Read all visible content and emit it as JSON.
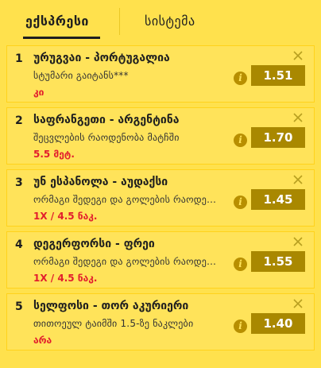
{
  "tabs": [
    {
      "label": "ექსპრესი"
    },
    {
      "label": "სისტემა"
    }
  ],
  "bets": [
    {
      "number": "1",
      "title": "ურუგვაი - პორტუგალია",
      "market": "სტუმარი გაიტანს***",
      "pick": "კი",
      "odd": "1.51"
    },
    {
      "number": "2",
      "title": "საფრანგეთი - არგენტინა",
      "market": "შეცვლების რაოდენობა მატჩში",
      "pick": "5.5 მეტ.",
      "odd": "1.70"
    },
    {
      "number": "3",
      "title": "უნ ესპანოლა - აუდაქსი",
      "market": "ორმაგი შედეგი და გოლების რაოდენობა",
      "pick": "1X / 4.5 ნაკ.",
      "odd": "1.45"
    },
    {
      "number": "4",
      "title": "დეგერფორსი - ფრეი",
      "market": "ორმაგი შედეგი და გოლების რაოდენობა",
      "pick": "1X / 4.5 ნაკ.",
      "odd": "1.55"
    },
    {
      "number": "5",
      "title": "სელფოსი - თორ აკურიერი",
      "market": "თითოეულ ტაიმში 1.5-ზე ნაკლები",
      "pick": "არა",
      "odd": "1.40"
    }
  ],
  "icons": {
    "close": "close-icon",
    "info": "info-icon"
  },
  "colors": {
    "background": "#ffe14d",
    "odd_button": "#a98800",
    "pick_text": "#e21d2d"
  }
}
